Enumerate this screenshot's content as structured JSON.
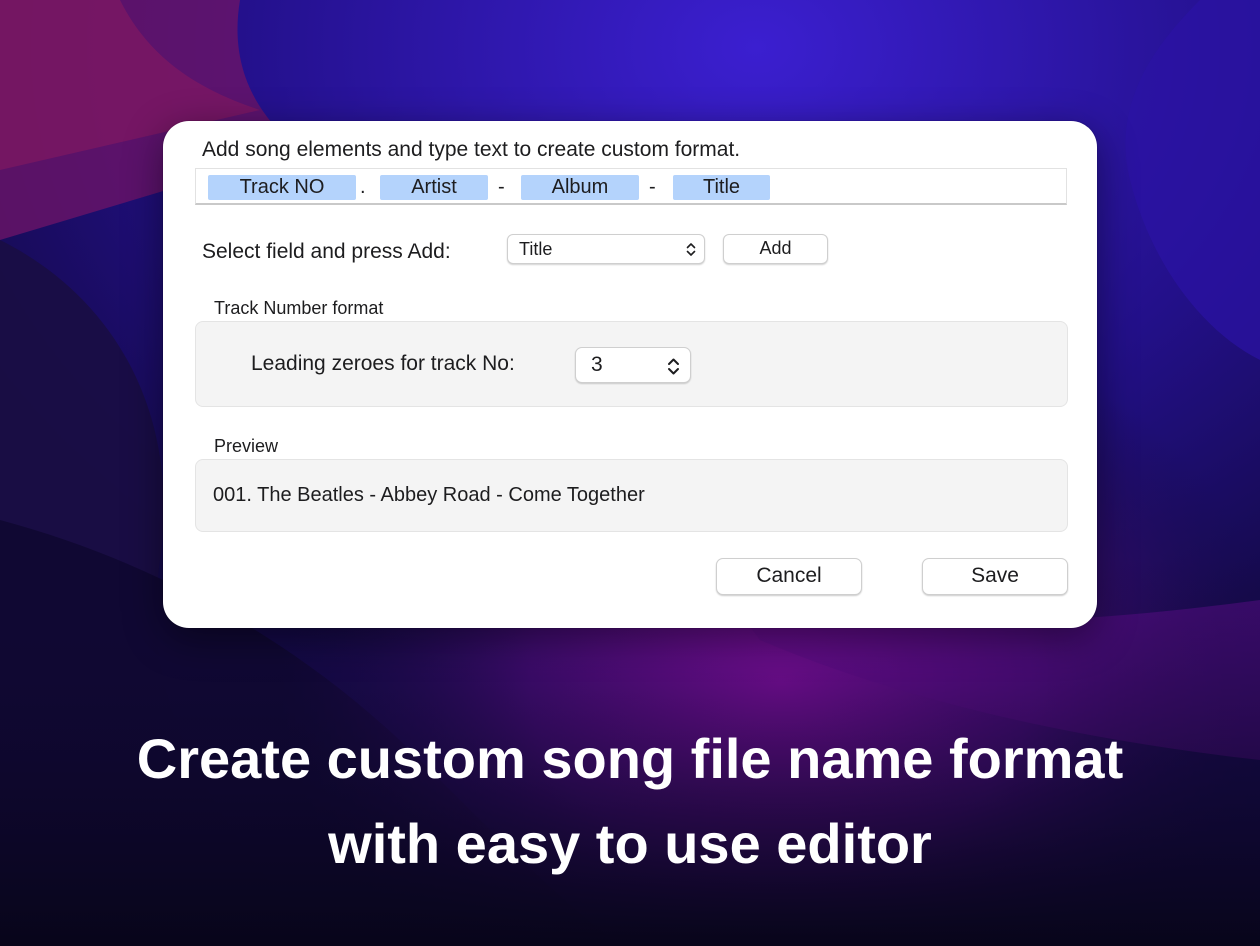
{
  "theme": {
    "wallpaper_colors": [
      "#1a0b6e",
      "#3a1aa8",
      "#2d1366",
      "#7a0c94",
      "#140a3a",
      "#0a0620"
    ],
    "token_color": "#b4d3fc",
    "dialog_background": "#ffffff",
    "group_background": "#f4f4f4"
  },
  "dialog": {
    "instruction": "Add song elements and type text to create custom format.",
    "format_tokens": [
      {
        "label": "Track NO"
      },
      {
        "separator": "."
      },
      {
        "label": "Artist"
      },
      {
        "separator": "-"
      },
      {
        "label": "Album"
      },
      {
        "separator": "-"
      },
      {
        "label": "Title"
      }
    ],
    "field_select": {
      "label": "Select field and press Add:",
      "selected": "Title",
      "icon": "chevron-up-down-icon"
    },
    "add_button": "Add",
    "track_number": {
      "section_title": "Track Number format",
      "leading_zeroes_label": "Leading zeroes for track No:",
      "leading_zeroes_value": "3"
    },
    "preview": {
      "section_title": "Preview",
      "text": "001. The Beatles - Abbey Road - Come Together"
    },
    "cancel_button": "Cancel",
    "save_button": "Save"
  },
  "caption": {
    "line1": "Create custom song file name format",
    "line2": "with easy to use editor"
  }
}
